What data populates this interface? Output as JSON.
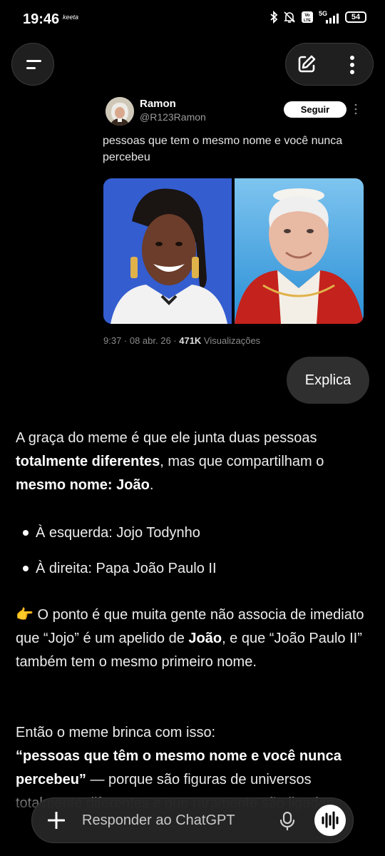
{
  "status_bar": {
    "time": "19:46",
    "carrier_icon_label": "keeta",
    "network": "5G",
    "volte": "Vo LTE",
    "battery": "54"
  },
  "top_bar": {
    "menu_icon": "hamburger-menu-icon",
    "new_chat_icon": "edit-icon",
    "more_icon": "more-vertical-icon"
  },
  "tweet": {
    "author_name": "Ramon",
    "handle": "@R123Ramon",
    "follow_label": "Seguir",
    "text": "pessoas que tem o mesmo nome e você nunca percebeu",
    "meta_prefix": "9:37 · 08 abr. 26 · ",
    "views_count": "471K",
    "views_label": " Visualizações"
  },
  "user_message": "Explica",
  "answer": {
    "p1_a": "A graça do meme é que ele junta duas pessoas ",
    "p1_b": "totalmente diferentes",
    "p1_c": ", mas que compartilham o ",
    "p1_d": "mesmo nome: João",
    "p1_e": ".",
    "bullets": [
      "À esquerda: Jojo Todynho",
      "À direita: Papa João Paulo II"
    ],
    "p2_emoji": "👉",
    "p2_a": " O ponto é que muita gente não associa de imediato que “Jojo” é um apelido de ",
    "p2_b": "João",
    "p2_c": ", e que “João Paulo II” também tem o mesmo primeiro nome.",
    "p3_a": "Então o meme brinca com isso:",
    "p3_b": "“pessoas que têm o mesmo nome e você nunca percebeu”",
    "p3_c": " — porque são figuras de universos totalmente diferentes e que raramente são ligadas."
  },
  "composer": {
    "placeholder": "Responder ao ChatGPT",
    "plus_icon": "plus-icon",
    "mic_icon": "mic-icon",
    "voice_icon": "voice-waveform-icon"
  }
}
